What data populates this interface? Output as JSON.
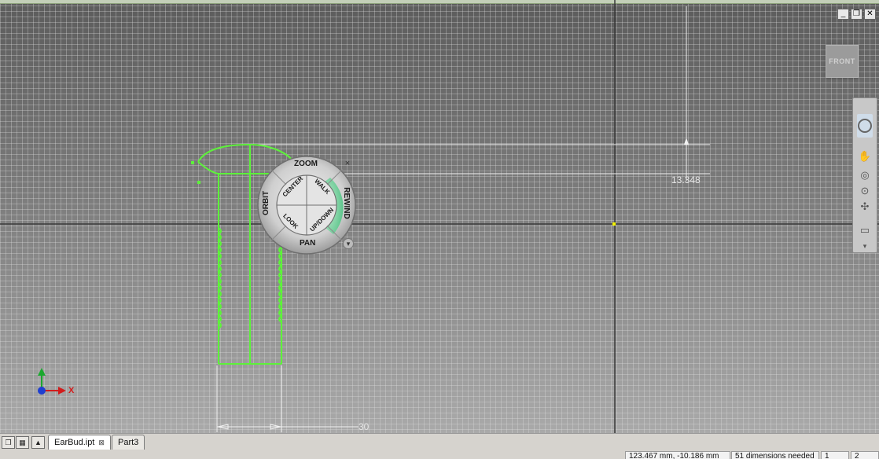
{
  "window": {
    "controls": [
      "_",
      "❐",
      "✕"
    ]
  },
  "viewcube": {
    "face_label": "FRONT"
  },
  "nav_wheel": {
    "zoom": "ZOOM",
    "orbit": "ORBIT",
    "pan": "PAN",
    "rewind": "REWIND",
    "center": "CENTER",
    "walk": "WALK",
    "look": "LOOK",
    "updown": "UP/DOWN",
    "close": "×",
    "menu": "▾"
  },
  "sketch": {
    "dimension_vertical": "13.348",
    "dimension_horizontal": "30",
    "axis_x_label": "X",
    "colors": {
      "geometry": "#5df23a",
      "dimension": "#f2f2f2",
      "axis_x": "#d21c1c",
      "axis_y": "#1aa82e",
      "origin": "#1f3fd1",
      "point": "#f3f300"
    }
  },
  "tabs": {
    "items": [
      {
        "label": "EarBud.ipt",
        "close": "⊠",
        "active": true
      },
      {
        "label": "Part3",
        "active": false
      }
    ]
  },
  "statusbar": {
    "coords": "123.467 mm, -10.186 mm",
    "dimensions_needed": "51 dimensions needed",
    "field1": "1",
    "field2": "2"
  }
}
